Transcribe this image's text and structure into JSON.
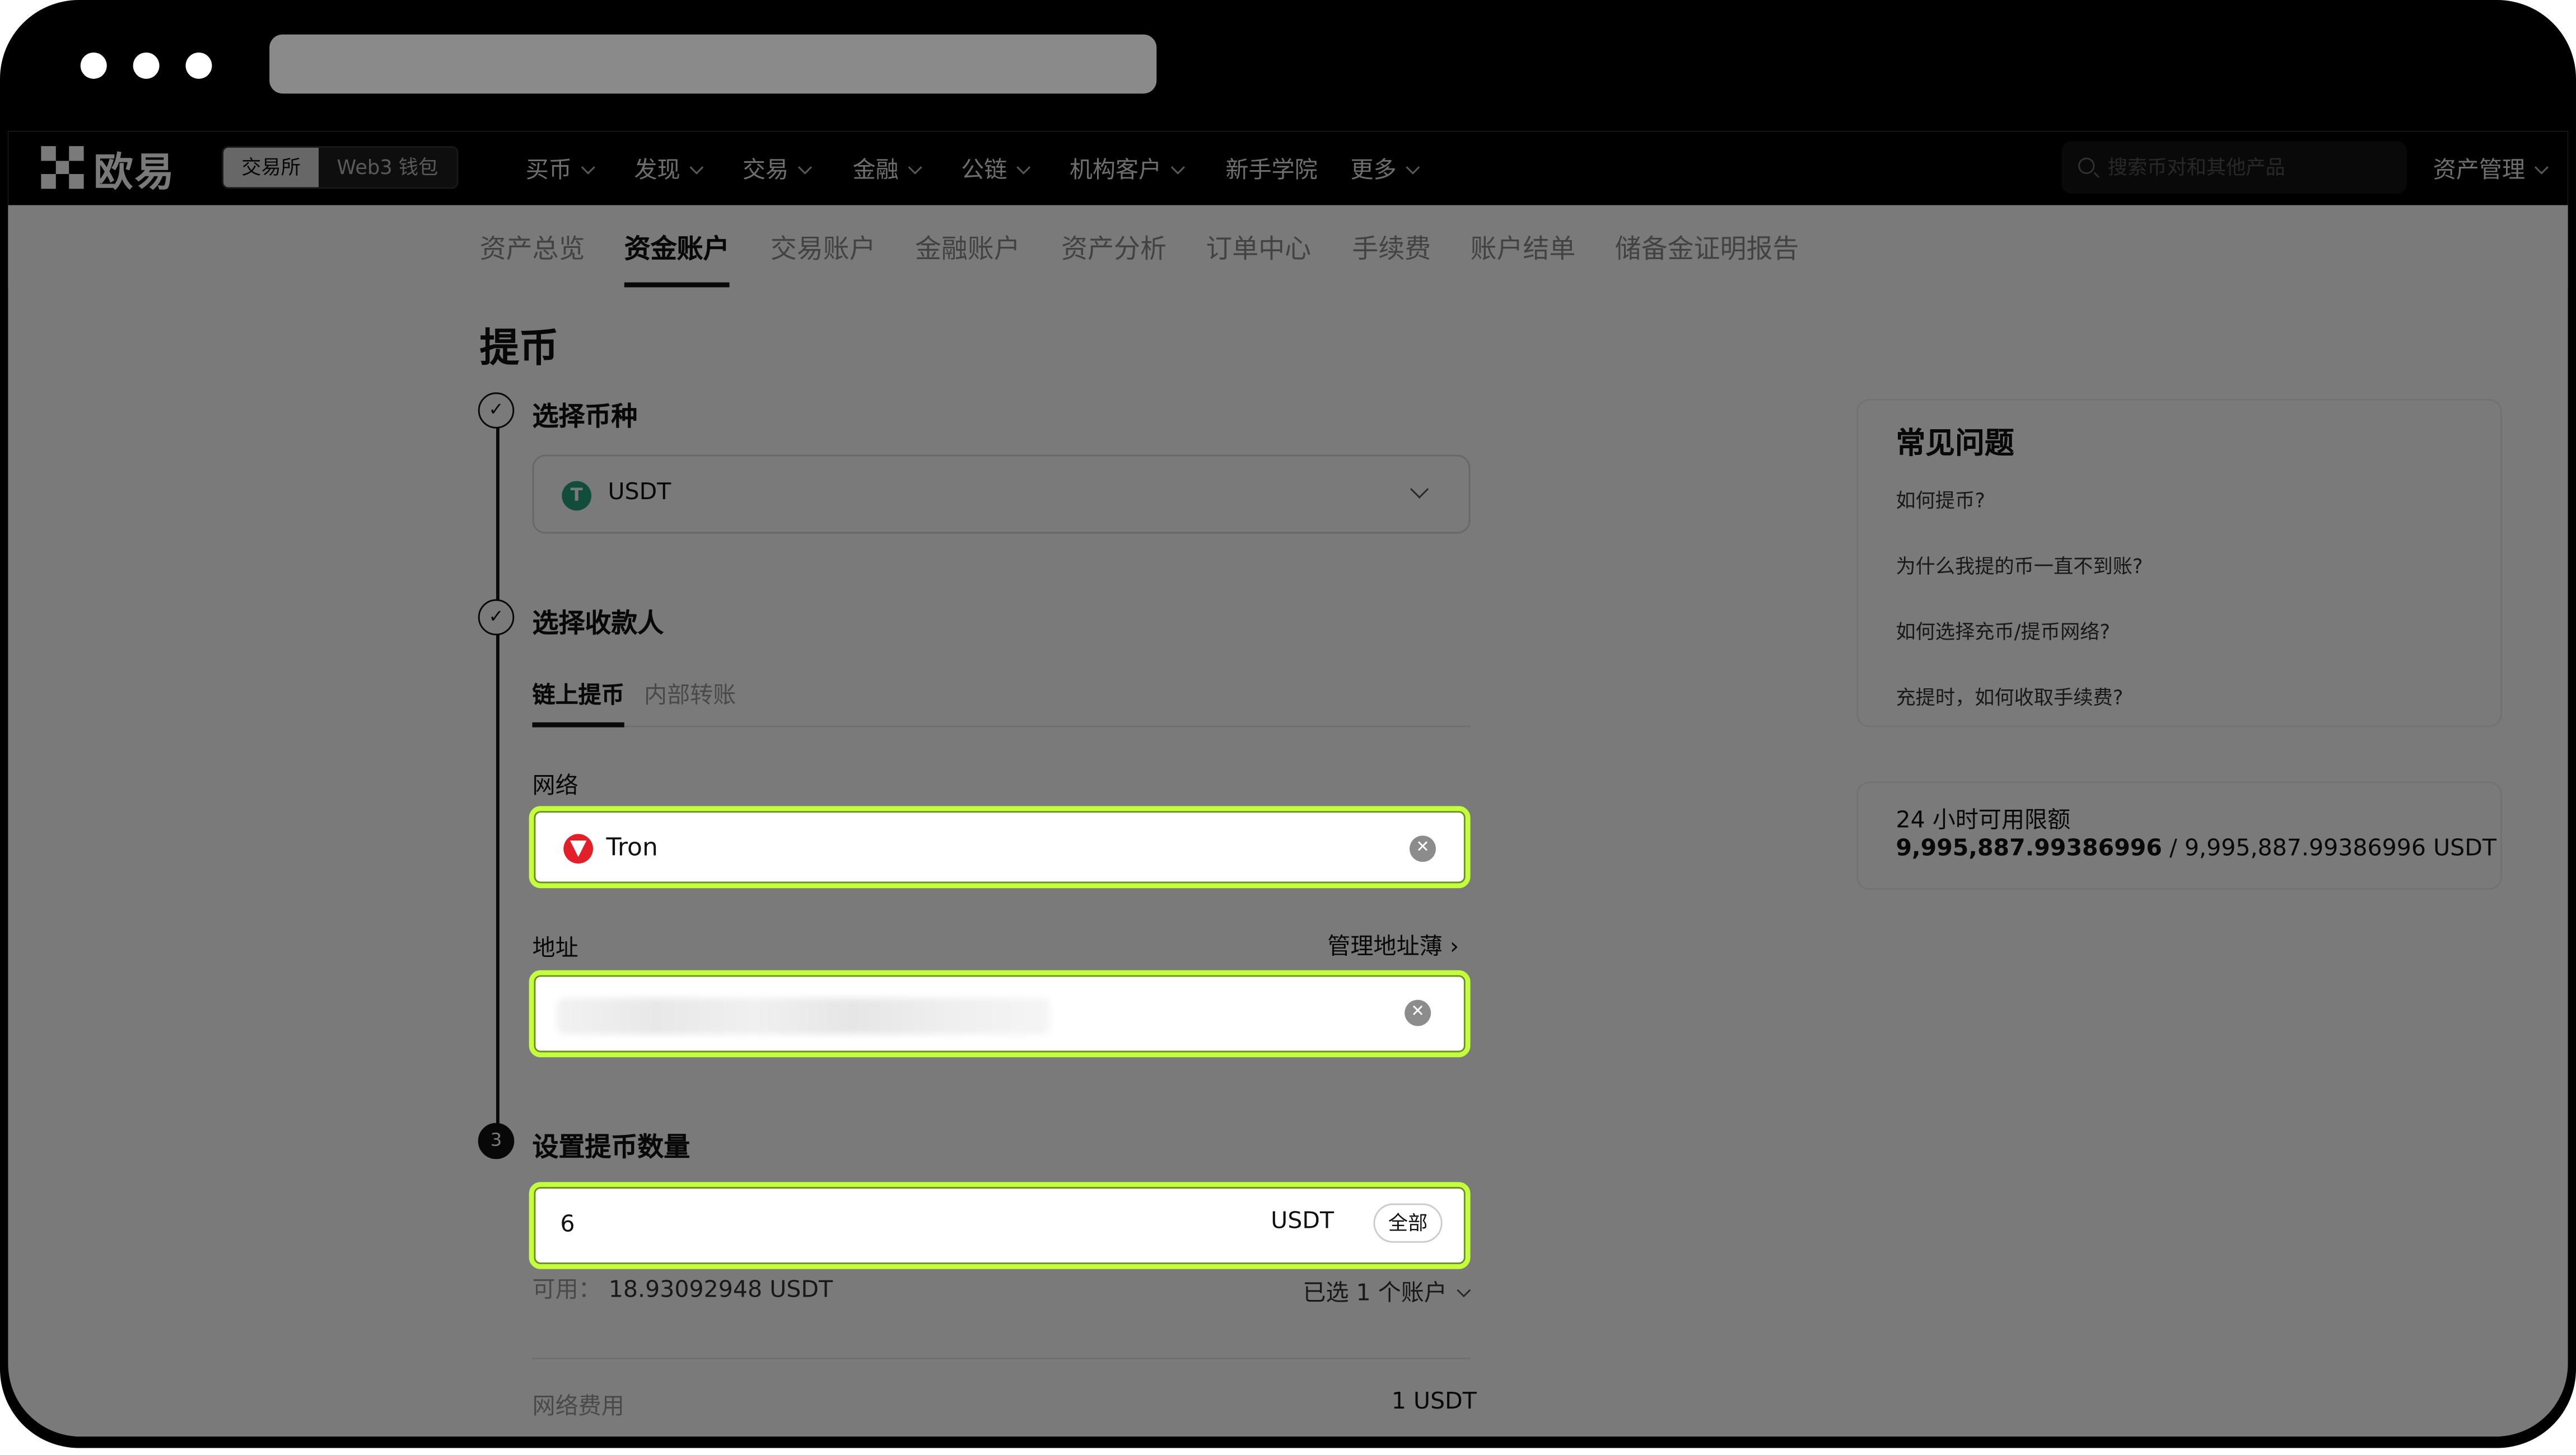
{
  "nav": {
    "logo": "欧易",
    "toggle": [
      "交易所",
      "Web3 钱包"
    ],
    "items": [
      "买币",
      "发现",
      "交易",
      "金融",
      "公链",
      "机构客户",
      "新手学院",
      "更多"
    ],
    "search_placeholder": "搜索币对和其他产品",
    "asset_management": "资产管理"
  },
  "subtabs": [
    "资产总览",
    "资金账户",
    "交易账户",
    "金融账户",
    "资产分析",
    "订单中心",
    "手续费",
    "账户结单",
    "储备金证明报告"
  ],
  "page": {
    "title": "提币",
    "steps": {
      "select_coin": "选择币种",
      "select_recipient": "选择收款人",
      "set_amount": "设置提币数量",
      "step3_number": "3"
    },
    "coin": {
      "icon_letter": "T",
      "value": "USDT"
    },
    "recipient_tabs": [
      "链上提币",
      "内部转账"
    ],
    "network": {
      "label": "网络",
      "value": "Tron"
    },
    "address": {
      "label": "地址",
      "manage_link": "管理地址薄"
    },
    "amount": {
      "value": "6",
      "unit": "USDT",
      "all_button": "全部"
    },
    "available": {
      "label": "可用：",
      "value": "18.93092948 USDT"
    },
    "accounts_selected": "已选 1 个账户",
    "network_fee": {
      "label": "网络费用",
      "value": "1 USDT"
    }
  },
  "sidebar": {
    "faq_title": "常见问题",
    "faq": [
      "如何提币?",
      "为什么我提的币一直不到账?",
      "如何选择充币/提币网络?",
      "充提时，如何收取手续费?"
    ],
    "limit_label": "24 小时可用限额",
    "limit_used": "9,995,887.99386996",
    "limit_total": " / 9,995,887.99386996 USDT"
  },
  "colors": {
    "highlight": "#c3ff3d",
    "usdt": "#26a17b",
    "tron": "#e3202a"
  }
}
